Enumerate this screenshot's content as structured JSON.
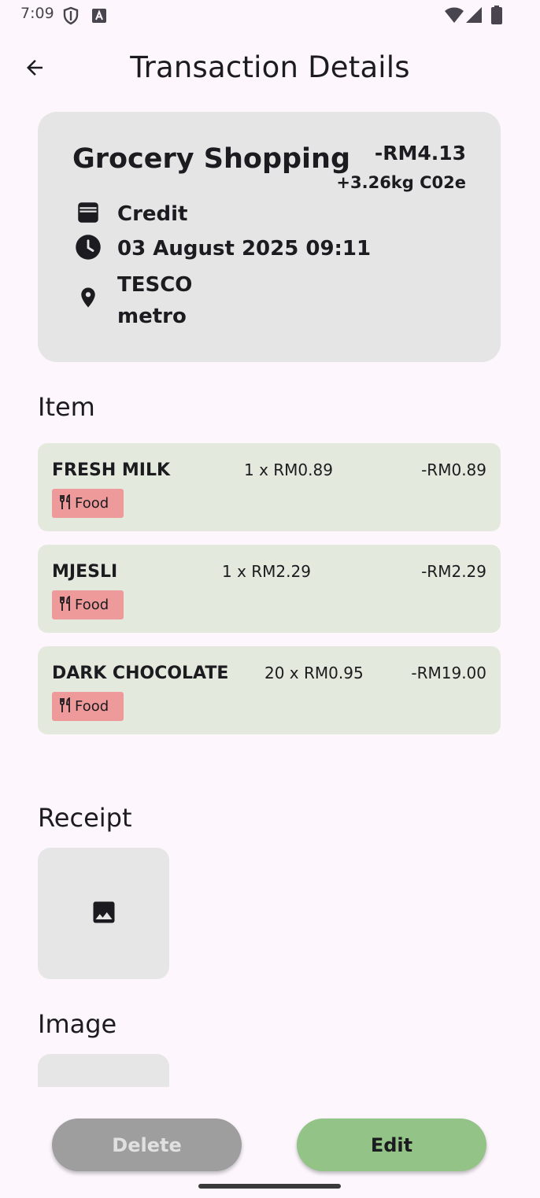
{
  "status_bar": {
    "time": "7:09"
  },
  "app_bar": {
    "title": "Transaction Details"
  },
  "transaction": {
    "title": "Grocery Shopping",
    "amount": "-RM4.13",
    "co2": "+3.26kg C02e",
    "payment_method": "Credit",
    "datetime": "03 August 2025 09:11",
    "location_line1": "TESCO",
    "location_line2": "metro"
  },
  "sections": {
    "items": "Item",
    "receipt": "Receipt",
    "image": "Image"
  },
  "items": [
    {
      "name": "FRESH MILK",
      "qty": "1 x RM0.89",
      "total": "-RM0.89",
      "category": "Food"
    },
    {
      "name": "MJESLI",
      "qty": "1 x RM2.29",
      "total": "-RM2.29",
      "category": "Food"
    },
    {
      "name": "DARK CHOCOLATE",
      "qty": "20 x RM0.95",
      "total": "-RM19.00",
      "category": "Food"
    }
  ],
  "buttons": {
    "delete": "Delete",
    "edit": "Edit"
  },
  "colors": {
    "background": "#fdf7fd",
    "card": "#e5e5e5",
    "item_card": "#e3e9dc",
    "tag": "#ef9a9a",
    "edit_button": "#93c386",
    "delete_button": "#9e9e9e"
  },
  "icons": {
    "back": "arrow-left-icon",
    "payment": "wallet-icon",
    "time": "clock-icon",
    "location": "location-pin-icon",
    "category": "restaurant-icon",
    "receipt": "image-icon"
  }
}
